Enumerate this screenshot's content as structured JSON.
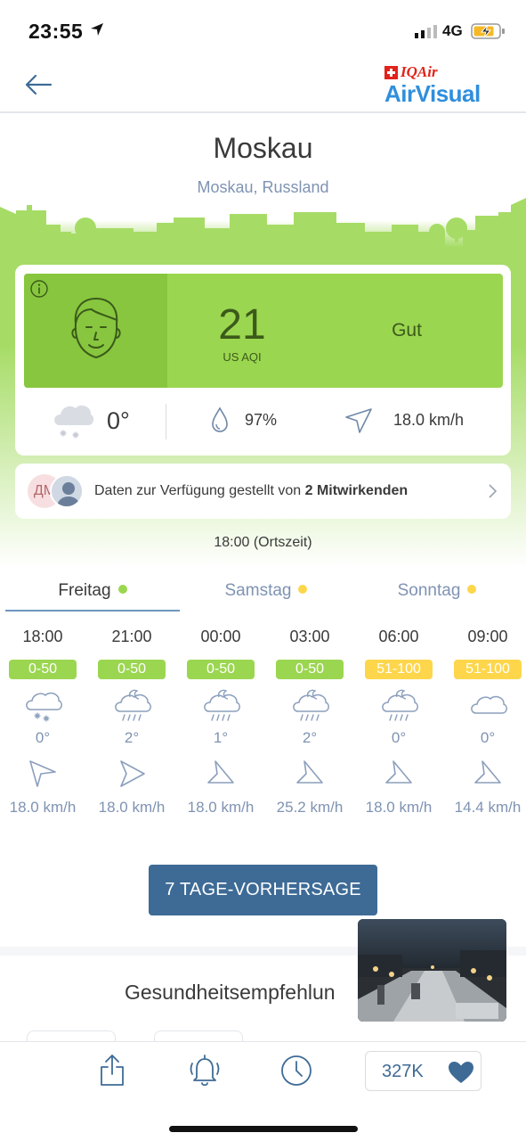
{
  "status_bar": {
    "time": "23:55",
    "network": "4G"
  },
  "header": {
    "back_icon": "arrow-left-icon",
    "logo_top": "IQAir",
    "logo_bottom": "AirVisual"
  },
  "location": {
    "city": "Moskau",
    "region": "Moskau, Russland"
  },
  "aqi": {
    "value": "21",
    "unit": "US AQI",
    "level": "Gut",
    "color": "#9bd650"
  },
  "weather": {
    "temperature": "0°",
    "humidity": "97%",
    "wind": "18.0 km/h",
    "condition_icon": "snow-cloud-icon"
  },
  "contributors": {
    "avatar_initials": "ДМ",
    "text": "Daten zur Verfügung gestellt von ",
    "count_text": "2 Mitwirkenden"
  },
  "local_time": "18:00 (Ortszeit)",
  "day_tabs": [
    {
      "label": "Freitag",
      "dot_color": "#9bd650"
    },
    {
      "label": "Samstag",
      "dot_color": "#fdd64b"
    },
    {
      "label": "Sonntag",
      "dot_color": "#fdd64b"
    }
  ],
  "hourly": [
    {
      "time": "18:00",
      "aqi": "0-50",
      "aqi_color": "#9bd650",
      "icon": "snow-cloud-icon",
      "temp": "0°",
      "wind": "18.0 km/h"
    },
    {
      "time": "21:00",
      "aqi": "0-50",
      "aqi_color": "#9bd650",
      "icon": "night-rain-cloud-icon",
      "temp": "2°",
      "wind": "18.0 km/h"
    },
    {
      "time": "00:00",
      "aqi": "0-50",
      "aqi_color": "#9bd650",
      "icon": "night-rain-cloud-icon",
      "temp": "1°",
      "wind": "18.0 km/h"
    },
    {
      "time": "03:00",
      "aqi": "0-50",
      "aqi_color": "#9bd650",
      "icon": "night-rain-cloud-icon",
      "temp": "2°",
      "wind": "25.2 km/h"
    },
    {
      "time": "06:00",
      "aqi": "51-100",
      "aqi_color": "#fdd64b",
      "icon": "night-rain-cloud-icon",
      "temp": "0°",
      "wind": "18.0 km/h"
    },
    {
      "time": "09:00",
      "aqi": "51-100",
      "aqi_color": "#fdd64b",
      "icon": "cloud-icon",
      "temp": "0°",
      "wind": "14.4 km/h"
    }
  ],
  "forecast_button": "7 TAGE-VORHERSAGE",
  "health_title": "Gesundheitsempfehlun",
  "bottom_bar": {
    "likes": "327K"
  }
}
